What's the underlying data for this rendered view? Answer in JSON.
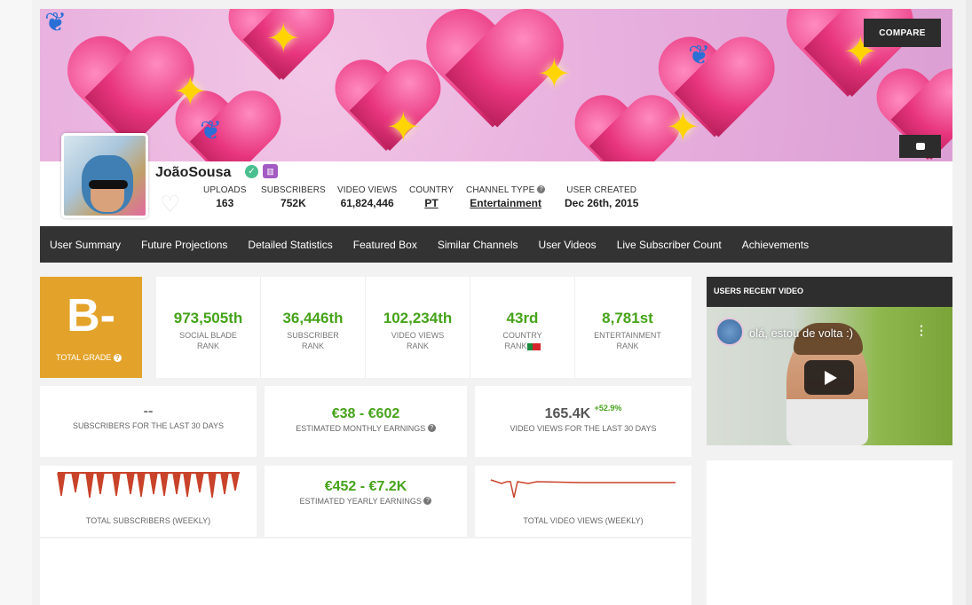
{
  "banner": {
    "compare_label": "COMPARE",
    "youtube_icon": "youtube-icon"
  },
  "channel": {
    "name": "JoãoSousa",
    "stats": [
      {
        "label": "UPLOADS",
        "value": "163"
      },
      {
        "label": "SUBSCRIBERS",
        "value": "752K"
      },
      {
        "label": "VIDEO VIEWS",
        "value": "61,824,446"
      },
      {
        "label": "COUNTRY",
        "value": "PT"
      },
      {
        "label": "CHANNEL TYPE",
        "value": "Entertainment"
      },
      {
        "label": "USER CREATED",
        "value": "Dec 26th, 2015"
      }
    ]
  },
  "nav": {
    "items": [
      "User Summary",
      "Future Projections",
      "Detailed Statistics",
      "Featured Box",
      "Similar Channels",
      "User Videos",
      "Live Subscriber Count",
      "Achievements"
    ]
  },
  "grade": {
    "letter": "B-",
    "label": "TOTAL GRADE"
  },
  "ranks": [
    {
      "value": "973,505th",
      "label1": "SOCIAL BLADE",
      "label2": "RANK"
    },
    {
      "value": "36,446th",
      "label1": "SUBSCRIBER",
      "label2": "RANK"
    },
    {
      "value": "102,234th",
      "label1": "VIDEO VIEWS",
      "label2": "RANK"
    },
    {
      "value": "43rd",
      "label1": "COUNTRY",
      "label2": "RANK"
    },
    {
      "value": "8,781st",
      "label1": "ENTERTAINMENT",
      "label2": "RANK"
    }
  ],
  "cards": {
    "subs30": {
      "value": "--",
      "label": "SUBSCRIBERS FOR THE LAST 30 DAYS"
    },
    "monthly": {
      "value": "€38  -  €602",
      "label": "ESTIMATED MONTHLY EARNINGS"
    },
    "views30": {
      "value": "165.4K",
      "delta": "+52.9%",
      "label": "VIDEO VIEWS FOR THE LAST 30 DAYS"
    },
    "subs_weekly": {
      "label": "TOTAL SUBSCRIBERS (WEEKLY)"
    },
    "yearly": {
      "value": "€452  -  €7.2K",
      "label": "ESTIMATED YEARLY EARNINGS"
    },
    "views_weekly": {
      "label": "TOTAL VIDEO VIEWS (WEEKLY)"
    }
  },
  "recent_video": {
    "panel_title": "USERS RECENT VIDEO",
    "video_title": "olá, estou de volta :)"
  },
  "colors": {
    "accent_green": "#46a31a",
    "grade_orange": "#e3a32a",
    "nav_dark": "#333333",
    "sparkline_red": "#c9432a"
  }
}
